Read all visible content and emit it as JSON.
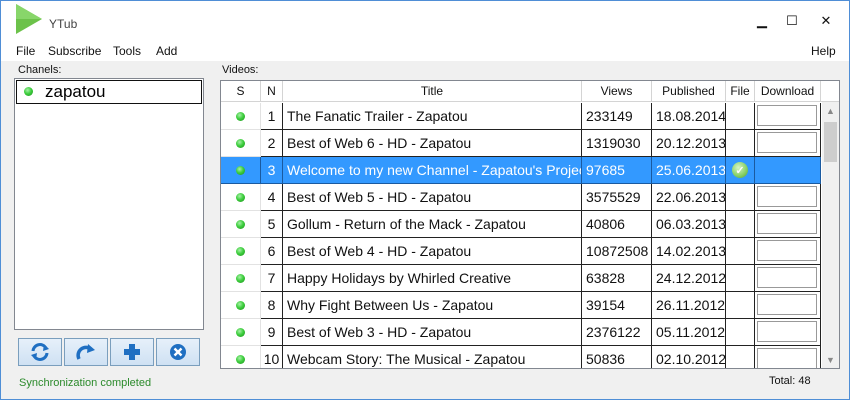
{
  "app": {
    "title": "YTub"
  },
  "window_controls": {
    "minimize": "▁",
    "maximize": "☐",
    "close": "✕"
  },
  "menu": {
    "file": "File",
    "subscribe": "Subscribe",
    "tools": "Tools",
    "add": "Add",
    "help": "Help"
  },
  "channels": {
    "label": "Chanels:",
    "items": [
      {
        "name": "zapatou",
        "status": "active"
      }
    ]
  },
  "toolbar": {
    "refresh_icon": "refresh-icon",
    "redo_icon": "redo-icon",
    "add_icon": "plus-icon",
    "remove_icon": "remove-icon"
  },
  "videos": {
    "label": "Videos:",
    "columns": {
      "s": "S",
      "n": "N",
      "title": "Title",
      "views": "Views",
      "published": "Published",
      "file": "File",
      "download": "Download"
    },
    "rows": [
      {
        "n": "1",
        "title": "The Fanatic Trailer - Zapatou",
        "views": "233149",
        "published": "18.08.2014",
        "file": false,
        "selected": false
      },
      {
        "n": "2",
        "title": "Best of Web 6 - HD - Zapatou",
        "views": "1319030",
        "published": "20.12.2013",
        "file": false,
        "selected": false
      },
      {
        "n": "3",
        "title": "Welcome to my new Channel - Zapatou's Project",
        "views": "97685",
        "published": "25.06.2013",
        "file": true,
        "selected": true
      },
      {
        "n": "4",
        "title": "Best of Web 5 - HD - Zapatou",
        "views": "3575529",
        "published": "22.06.2013",
        "file": false,
        "selected": false
      },
      {
        "n": "5",
        "title": "Gollum - Return of the Mack - Zapatou",
        "views": "40806",
        "published": "06.03.2013",
        "file": false,
        "selected": false
      },
      {
        "n": "6",
        "title": "Best of Web 4 - HD - Zapatou",
        "views": "10872508",
        "published": "14.02.2013",
        "file": false,
        "selected": false
      },
      {
        "n": "7",
        "title": "Happy Holidays by Whirled Creative",
        "views": "63828",
        "published": "24.12.2012",
        "file": false,
        "selected": false
      },
      {
        "n": "8",
        "title": "Why Fight Between Us - Zapatou",
        "views": "39154",
        "published": "26.11.2012",
        "file": false,
        "selected": false
      },
      {
        "n": "9",
        "title": "Best of Web 3 - HD - Zapatou",
        "views": "2376122",
        "published": "05.11.2012",
        "file": false,
        "selected": false
      },
      {
        "n": "10",
        "title": "Webcam Story: The Musical  -  Zapatou",
        "views": "50836",
        "published": "02.10.2012",
        "file": false,
        "selected": false
      }
    ]
  },
  "status": {
    "message": "Synchronization completed",
    "total": "Total: 48"
  },
  "colors": {
    "accent": "#3399ff",
    "status_green": "#2b8a2b",
    "window_border": "#4f8ed6"
  }
}
